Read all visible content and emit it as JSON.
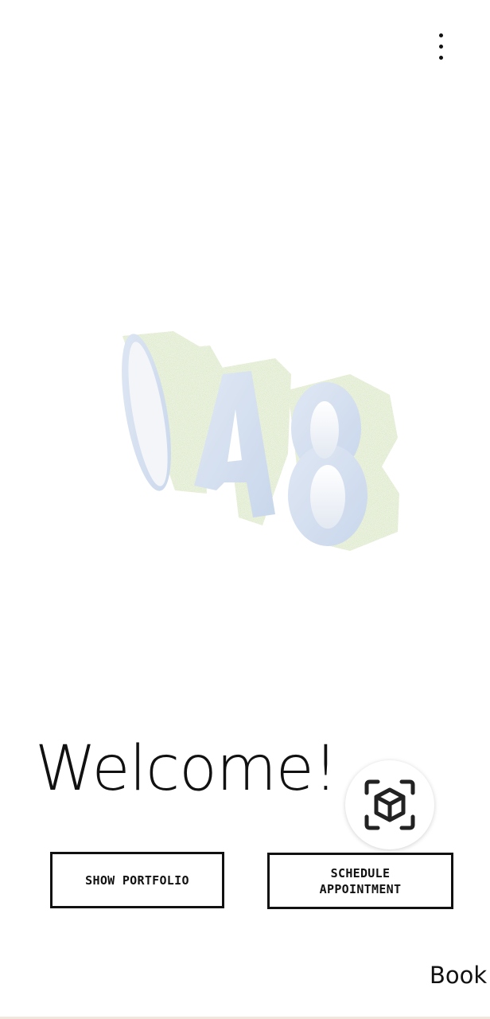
{
  "header": {
    "menu_icon": "more-vertical-icon"
  },
  "logo": {
    "text": "A8",
    "colors": {
      "face": "#cfdcee",
      "moss": "#9cc56b"
    }
  },
  "main": {
    "welcome_text": "Welcome!",
    "ar_button_icon": "ar-cube-icon",
    "show_portfolio_label": "SHOW PORTFOLIO",
    "schedule_label": "SCHEDULE\nAPPOINTMENT"
  },
  "footer": {
    "book_label": "Book"
  }
}
